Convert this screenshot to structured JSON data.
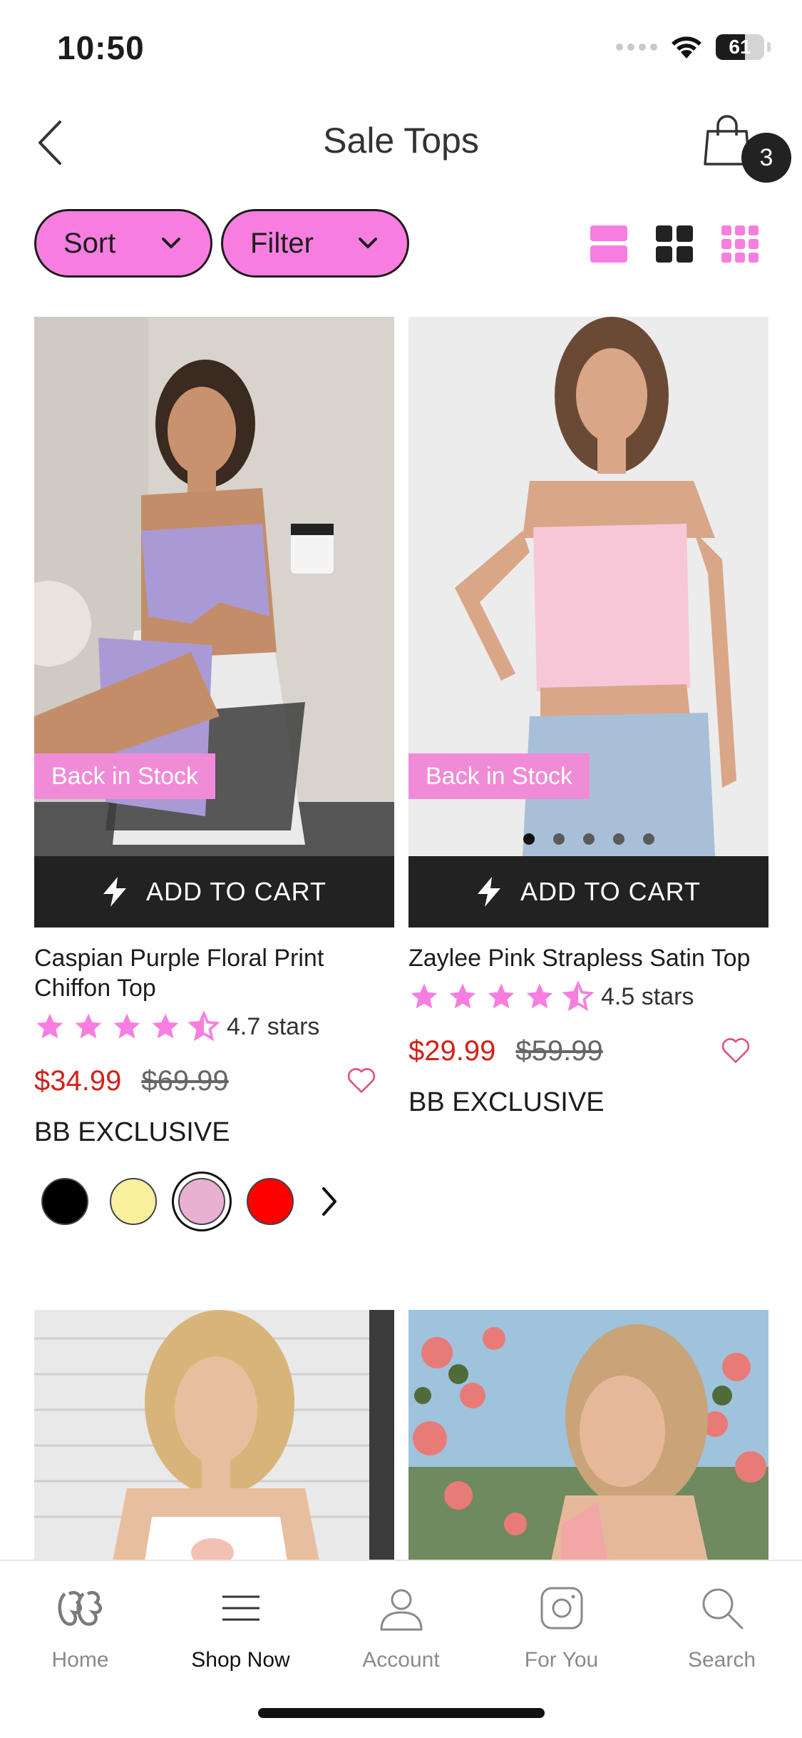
{
  "status": {
    "time": "10:50",
    "battery": "61"
  },
  "header": {
    "title": "Sale Tops",
    "cart_count": "3"
  },
  "toolbar": {
    "sort_label": "Sort",
    "filter_label": "Filter"
  },
  "products": [
    {
      "badge": "Back in Stock",
      "add_to_cart": "ADD TO CART",
      "name": "Caspian Purple Floral Print Chiffon Top",
      "rating": 4.7,
      "rating_text": "4.7 stars",
      "sale_price": "$34.99",
      "original_price": "$69.99",
      "tag": "BB EXCLUSIVE",
      "swatches": [
        "#000000",
        "#f9f09e",
        "#e8b1d2",
        "#ff0000"
      ],
      "selected_swatch": 2
    },
    {
      "badge": "Back in Stock",
      "add_to_cart": "ADD TO CART",
      "name": "Zaylee Pink Strapless Satin Top",
      "rating": 4.5,
      "rating_text": "4.5 stars",
      "sale_price": "$29.99",
      "original_price": "$59.99",
      "tag": "BB EXCLUSIVE",
      "image_count": 5,
      "active_image": 0
    }
  ],
  "nav": {
    "items": [
      {
        "label": "Home",
        "icon": "bb-logo-icon"
      },
      {
        "label": "Shop Now",
        "icon": "menu-icon"
      },
      {
        "label": "Account",
        "icon": "user-icon"
      },
      {
        "label": "For You",
        "icon": "instagram-icon"
      },
      {
        "label": "Search",
        "icon": "search-icon"
      }
    ],
    "active": "Shop Now"
  },
  "colors": {
    "accent_pink": "#f77ee0",
    "sale_red": "#d0211b",
    "dark": "#222222"
  }
}
